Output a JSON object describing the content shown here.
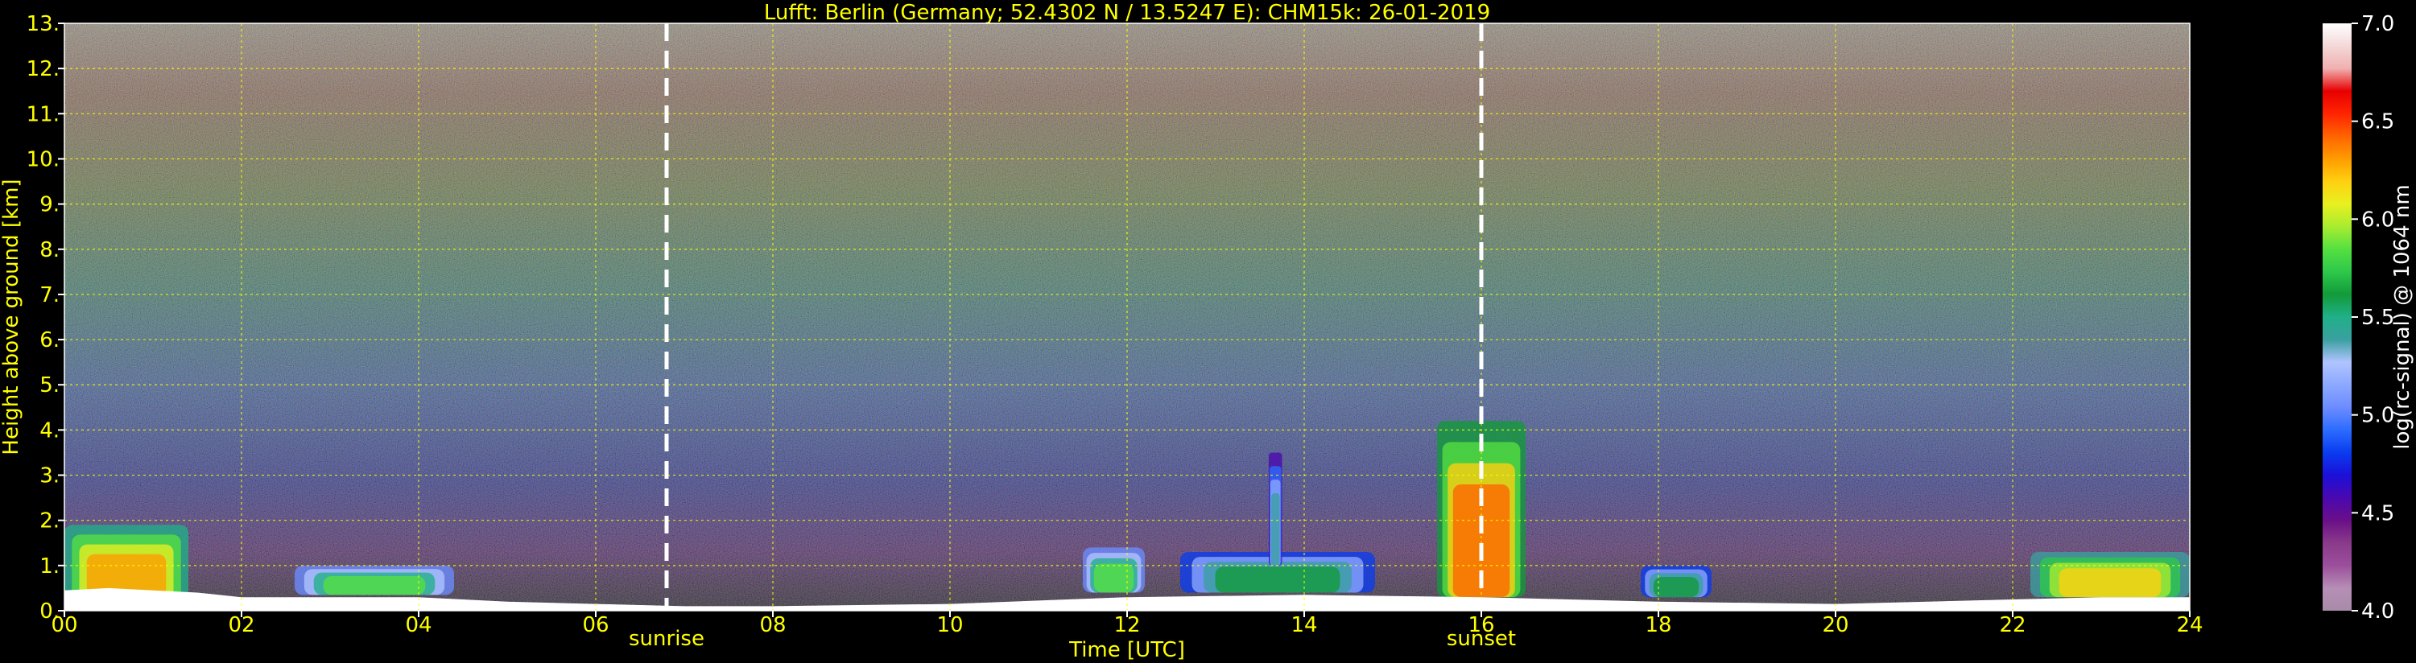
{
  "chart_data": {
    "type": "heatmap",
    "title": "Lufft: Berlin (Germany; 52.4302 N / 13.5247 E):    CHM15k: 26-01-2019",
    "xlabel": "Time [UTC]",
    "ylabel": "Height above ground [km]",
    "xlim": [
      0,
      24
    ],
    "ylim": [
      0,
      13
    ],
    "x_ticks": [
      0,
      2,
      4,
      6,
      8,
      10,
      12,
      14,
      16,
      18,
      20,
      22,
      24
    ],
    "x_tick_labels": [
      "00",
      "02",
      "04",
      "06",
      "08",
      "10",
      "12",
      "14",
      "16",
      "18",
      "20",
      "22",
      "24"
    ],
    "y_ticks": [
      0,
      1,
      2,
      3,
      4,
      5,
      6,
      7,
      8,
      9,
      10,
      11,
      12,
      13
    ],
    "y_tick_labels": [
      "0.",
      "1.",
      "2.",
      "3.",
      "4.",
      "5.",
      "6.",
      "7.",
      "8.",
      "9.",
      "10.",
      "11.",
      "12.",
      "13."
    ],
    "grid": true,
    "events": [
      {
        "label": "sunrise",
        "time": 6.8
      },
      {
        "label": "sunset",
        "time": 16.0
      }
    ],
    "colorbar": {
      "label": "log(rc-signal) @ 1064 nm",
      "range": [
        4.0,
        7.0
      ],
      "tick_values": [
        4.0,
        4.5,
        5.0,
        5.5,
        6.0,
        6.5,
        7.0
      ],
      "tick_labels": [
        "4.0",
        "4.5",
        "5.0",
        "5.5",
        "6.0",
        "6.5",
        "7.0"
      ],
      "colors": [
        "#a88ca8",
        "#b68eb6",
        "#9b4f9b",
        "#8a3a8a",
        "#6a0f88",
        "#4a08b0",
        "#1b10d8",
        "#0a3cf0",
        "#2c6cff",
        "#6c8cff",
        "#8ca8ff",
        "#b0c4ff",
        "#3aa0a0",
        "#20b088",
        "#129a3a",
        "#2ec84a",
        "#54e040",
        "#a8ec30",
        "#e8f020",
        "#ffd010",
        "#ff9c00",
        "#ff6400",
        "#ff2400",
        "#e80000",
        "#f0b0b0",
        "#f4d8d8",
        "#ffffff"
      ]
    },
    "layers": [
      {
        "name": "surface",
        "x": [
          0,
          0.5,
          1.0,
          1.5,
          2,
          3,
          4,
          5,
          6,
          7,
          8,
          10,
          12,
          14,
          16,
          17,
          18,
          20,
          22,
          23,
          24
        ],
        "y": [
          0.45,
          0.5,
          0.45,
          0.4,
          0.3,
          0.3,
          0.3,
          0.2,
          0.15,
          0.1,
          0.1,
          0.15,
          0.3,
          0.35,
          0.3,
          0.25,
          0.2,
          0.15,
          0.25,
          0.3,
          0.3
        ]
      }
    ],
    "features": [
      {
        "t0": 0.0,
        "t1": 1.4,
        "bottom": 0.1,
        "top": 1.9,
        "level": 6.3
      },
      {
        "t0": 2.6,
        "t1": 4.4,
        "bottom": 0.35,
        "top": 1.0,
        "level": 5.8
      },
      {
        "t0": 11.5,
        "t1": 12.2,
        "bottom": 0.4,
        "top": 1.4,
        "level": 5.8
      },
      {
        "t0": 12.6,
        "t1": 14.8,
        "bottom": 0.4,
        "top": 1.3,
        "level": 5.6
      },
      {
        "t0": 13.6,
        "t1": 13.75,
        "bottom": 1.0,
        "top": 3.5,
        "level": 5.4
      },
      {
        "t0": 15.5,
        "t1": 16.5,
        "bottom": 0.3,
        "top": 4.2,
        "level": 6.4
      },
      {
        "t0": 17.8,
        "t1": 18.6,
        "bottom": 0.3,
        "top": 1.0,
        "level": 5.6
      },
      {
        "t0": 22.2,
        "t1": 24.0,
        "bottom": 0.3,
        "top": 1.3,
        "level": 6.2
      }
    ]
  }
}
